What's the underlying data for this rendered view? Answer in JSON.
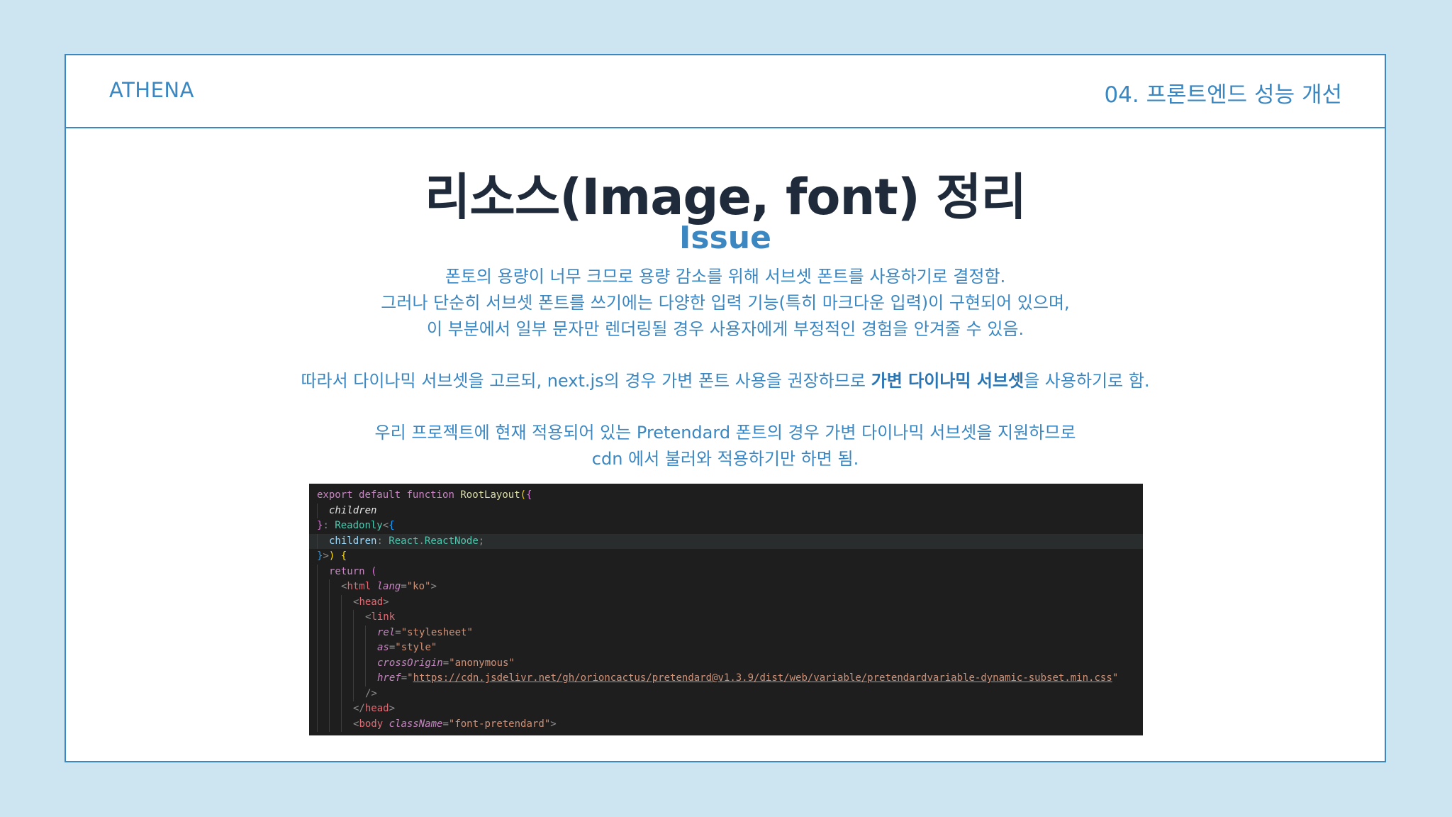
{
  "header": {
    "brand": "ATHENA",
    "section": "04. 프론트엔드 성능 개선"
  },
  "title": "리소스(Image, font) 정리",
  "subtitle": "Issue",
  "paragraphs": {
    "p1": [
      "폰토의 용량이 너무 크므로 용량 감소를 위해 서브셋 폰트를 사용하기로 결정함.",
      "그러나 단순히 서브셋 폰트를 쓰기에는 다양한 입력 기능(특히 마크다운 입력)이 구현되어 있으며,",
      "이 부분에서 일부 문자만 렌더링될 경우 사용자에게 부정적인 경험을 안겨줄 수 있음."
    ],
    "p2": {
      "before": "따라서 다이나믹 서브셋을 고르되, next.js의 경우 가변 폰트 사용을 권장하므로 ",
      "highlight": "가변 다이나믹 서브셋",
      "after": "을 사용하기로 함."
    },
    "p3": [
      "우리 프로젝트에 현재 적용되어 있는 Pretendard 폰트의 경우 가변 다이나믹 서브셋을 지원하므로",
      "cdn 에서 불러와 적용하기만 하면 됨."
    ]
  },
  "code": {
    "l1_export": "export",
    "l1_default": "default",
    "l1_function": "function",
    "l1_name": "RootLayout",
    "l2_children": "children",
    "l3_readonly": "Readonly",
    "l4_children": "children",
    "l4_react": "React",
    "l4_node": "ReactNode",
    "l6_return": "return",
    "l7_html": "html",
    "l7_lang": "lang",
    "l7_lang_val": "\"ko\"",
    "l8_head": "head",
    "l9_link": "link",
    "l10_rel": "rel",
    "l10_rel_val": "\"stylesheet\"",
    "l11_as": "as",
    "l11_as_val": "\"style\"",
    "l12_cross": "crossOrigin",
    "l12_cross_val": "\"anonymous\"",
    "l13_href": "href",
    "l13_url": "https://cdn.jsdelivr.net/gh/orioncactus/pretendard@v1.3.9/dist/web/variable/pretendardvariable-dynamic-subset.min.css",
    "l15_head": "head",
    "l16_body": "body",
    "l16_classname": "className",
    "l16_class_val": "\"font-pretendard\""
  },
  "colors": {
    "background": "#cde4f1",
    "accent": "#3a87c2",
    "title": "#1f2a3a",
    "code_background": "#1e1e1e"
  }
}
